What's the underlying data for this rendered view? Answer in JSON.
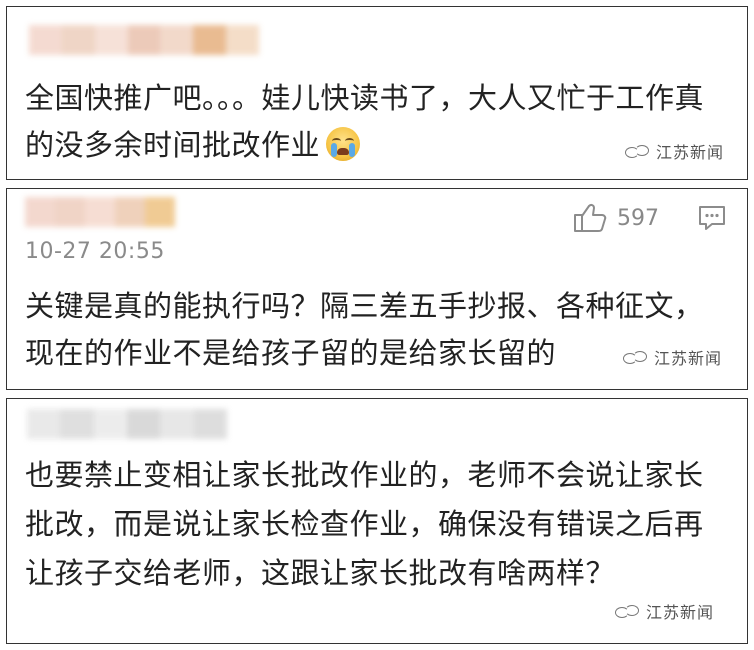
{
  "comments": [
    {
      "text": "全国快推广吧。。。娃儿快读书了，大人又忙于工作真的没多余时间批改作业",
      "emoji": "crying-face",
      "watermark": "江苏新闻"
    },
    {
      "timestamp": "10-27 20:55",
      "likes": "597",
      "text": "关键是真的能执行吗？隔三差五手抄报、各种征文，现在的作业不是给孩子留的是给家长留的",
      "watermark": "江苏新闻"
    },
    {
      "text": "也要禁止变相让家长批改作业的，老师不会说让家长批改，而是说让家长检查作业，确保没有错误之后再让孩子交给老师，这跟让家长批改有啥两样？",
      "watermark": "江苏新闻"
    }
  ],
  "colors": {
    "border": "#333333",
    "text": "#222222",
    "meta": "#8a8a8a"
  }
}
